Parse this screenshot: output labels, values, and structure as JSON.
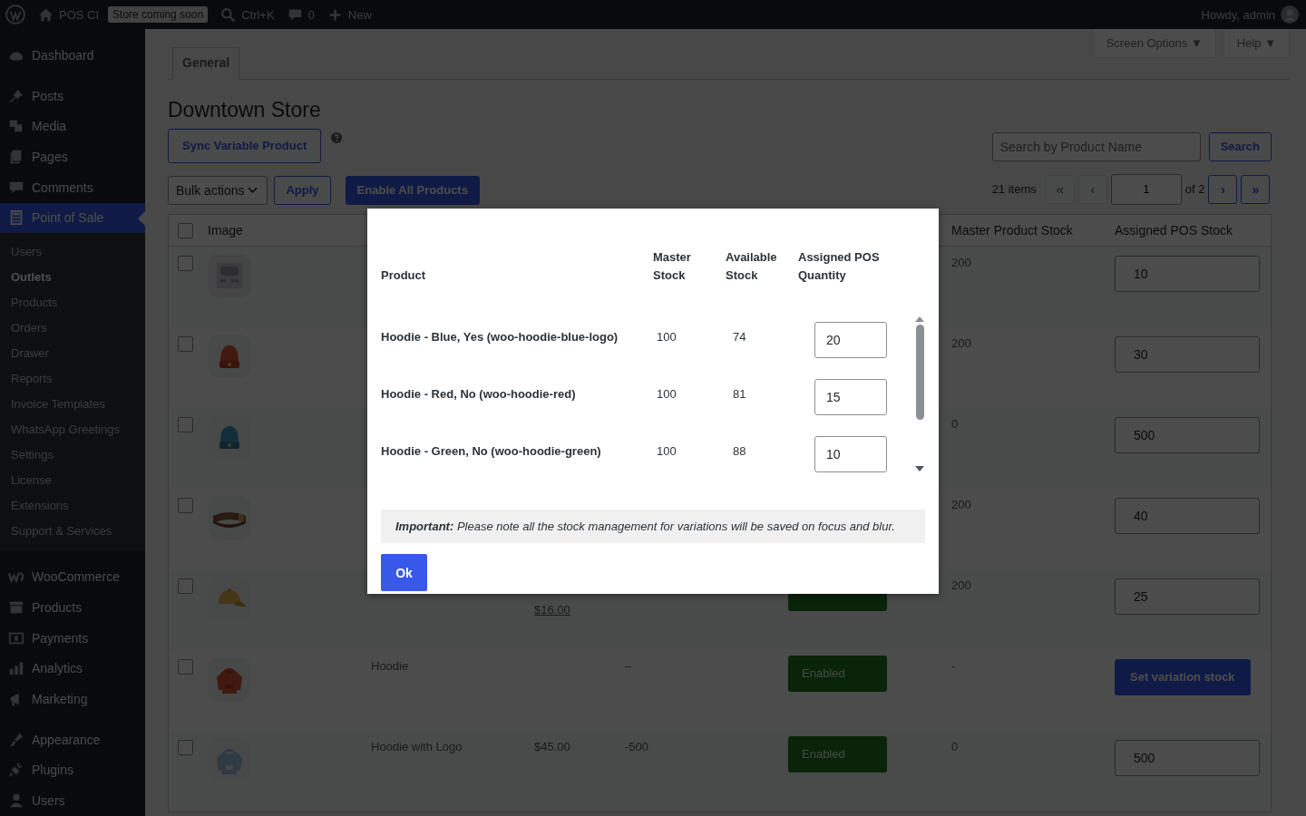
{
  "admin_bar": {
    "site": "POS CI",
    "badge": "Store coming soon",
    "search_shortcut": "Ctrl+K",
    "comments": "0",
    "new": "New",
    "greeting": "Howdy, admin"
  },
  "sidebar": {
    "groups": [
      [
        {
          "label": "Dashboard",
          "selected": false
        }
      ],
      [
        {
          "label": "Posts",
          "selected": false
        },
        {
          "label": "Media",
          "selected": false
        },
        {
          "label": "Pages",
          "selected": false
        },
        {
          "label": "Comments",
          "selected": false
        },
        {
          "label": "Point of Sale",
          "selected": true,
          "submenu": [
            {
              "label": "Users",
              "selected": false
            },
            {
              "label": "Outlets",
              "selected": true
            },
            {
              "label": "Products",
              "selected": false
            },
            {
              "label": "Orders",
              "selected": false
            },
            {
              "label": "Drawer",
              "selected": false
            },
            {
              "label": "Reports",
              "selected": false
            },
            {
              "label": "Invoice Templates",
              "selected": false
            },
            {
              "label": "WhatsApp Greetings",
              "selected": false
            },
            {
              "label": "Settings",
              "selected": false
            },
            {
              "label": "License",
              "selected": false
            },
            {
              "label": "Extensions",
              "selected": false
            },
            {
              "label": "Support & Services",
              "selected": false
            }
          ]
        }
      ],
      [
        {
          "label": "WooCommerce",
          "selected": false
        },
        {
          "label": "Products",
          "selected": false
        },
        {
          "label": "Payments",
          "selected": false
        },
        {
          "label": "Analytics",
          "selected": false
        },
        {
          "label": "Marketing",
          "selected": false
        }
      ],
      [
        {
          "label": "Appearance",
          "selected": false
        },
        {
          "label": "Plugins",
          "selected": false
        },
        {
          "label": "Users",
          "selected": false
        }
      ]
    ]
  },
  "screen_meta": [
    "Screen Options ▼",
    "Help ▼"
  ],
  "tabs": [
    {
      "label": "General",
      "selected": true
    }
  ],
  "title": "Downtown Store",
  "sync_button": "Sync Variable Product",
  "bulk_actions": "Bulk actions",
  "apply_button": "Apply",
  "enable_all_button": "Enable All Products",
  "search": {
    "placeholder": "Search by Product Name",
    "button": "Search"
  },
  "pagination": {
    "count": "21 items",
    "first": "«",
    "prev": "‹",
    "page": "1",
    "of": "of 2",
    "next": "›",
    "last": "»",
    "first_disabled": true,
    "last_disabled": false
  },
  "table": {
    "select_all_checked": false,
    "columns": [
      "Image",
      "Master Product Stock",
      "Assigned POS Stock"
    ],
    "rows": [
      {
        "checked": false,
        "master": "200",
        "assigned": {
          "kind": "input",
          "value": "10"
        }
      },
      {
        "checked": false,
        "master": "200",
        "assigned": {
          "kind": "input",
          "value": "30"
        }
      },
      {
        "checked": false,
        "master": "0",
        "assigned": {
          "kind": "input",
          "value": "500"
        }
      },
      {
        "checked": false,
        "master": "200",
        "assigned": {
          "kind": "input",
          "value": "40"
        }
      },
      {
        "checked": false,
        "price": "$16.00",
        "underlined": true,
        "status": {},
        "master": "200",
        "assigned": {
          "kind": "input",
          "value": "25"
        }
      },
      {
        "checked": false,
        "name": "Hoodie",
        "stock": "–",
        "status": {
          "label": "Enabled"
        },
        "master": "-",
        "assigned": {
          "kind": "button",
          "label": "Set variation stock"
        }
      },
      {
        "checked": false,
        "name": "Hoodie with Logo",
        "price": "$45.00",
        "stock": "-500",
        "status": {
          "label": "Enabled"
        },
        "master": "0",
        "assigned": {
          "kind": "input",
          "value": "500"
        }
      }
    ]
  },
  "modal": {
    "columns": [
      "Product",
      "Master Stock",
      "Available Stock",
      "Assigned POS Quantity"
    ],
    "rows": [
      {
        "product": "Hoodie - Blue, Yes (woo-hoodie-blue-logo)",
        "master": "100",
        "available": "74",
        "quantity": "20"
      },
      {
        "product": "Hoodie - Red, No (woo-hoodie-red)",
        "master": "100",
        "available": "81",
        "quantity": "15"
      },
      {
        "product": "Hoodie - Green, No (woo-hoodie-green)",
        "master": "100",
        "available": "88",
        "quantity": "10"
      }
    ],
    "notice": "**Important:** Please note all the stock management for variations will be saved on focus and blur.",
    "ok_button": "Ok"
  }
}
